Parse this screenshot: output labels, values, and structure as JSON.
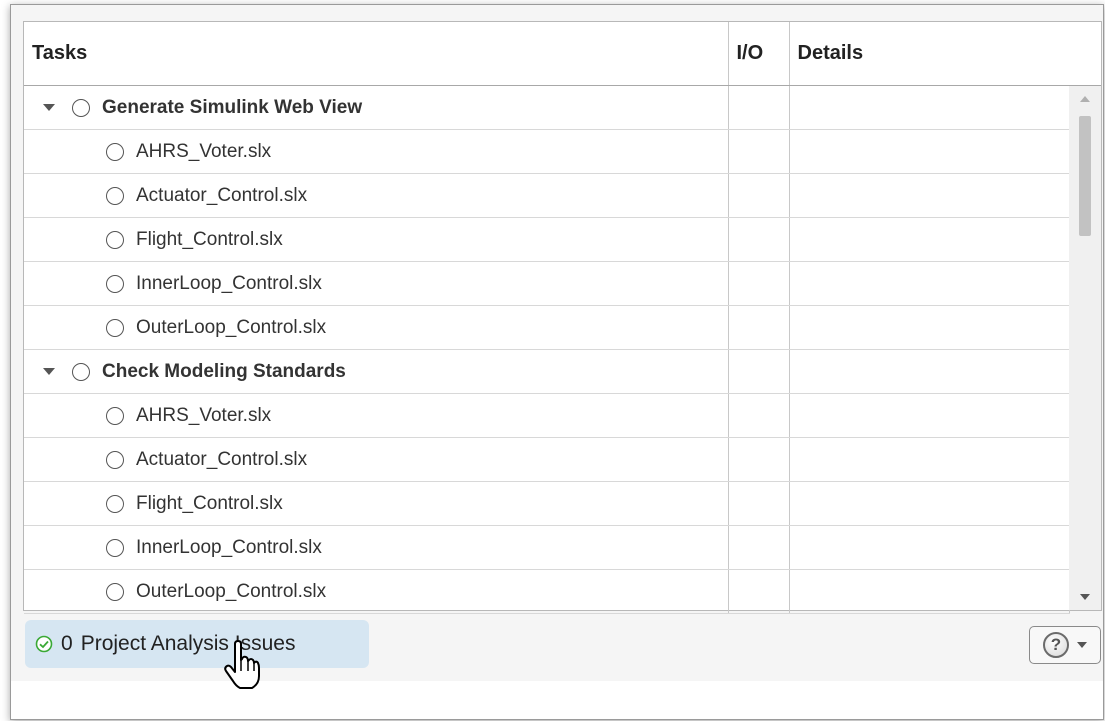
{
  "table": {
    "headers": {
      "tasks": "Tasks",
      "io": "I/O",
      "details": "Details"
    },
    "groups": [
      {
        "label": "Generate Simulink Web View",
        "children": [
          "AHRS_Voter.slx",
          "Actuator_Control.slx",
          "Flight_Control.slx",
          "InnerLoop_Control.slx",
          "OuterLoop_Control.slx"
        ]
      },
      {
        "label": "Check Modeling Standards",
        "children": [
          "AHRS_Voter.slx",
          "Actuator_Control.slx",
          "Flight_Control.slx",
          "InnerLoop_Control.slx",
          "OuterLoop_Control.slx"
        ]
      }
    ]
  },
  "status": {
    "count": "0",
    "label": "Project Analysis Issues"
  },
  "help": {
    "glyph": "?"
  },
  "colors": {
    "status_bg": "#d6e6f2",
    "ok_green": "#3aa935"
  }
}
